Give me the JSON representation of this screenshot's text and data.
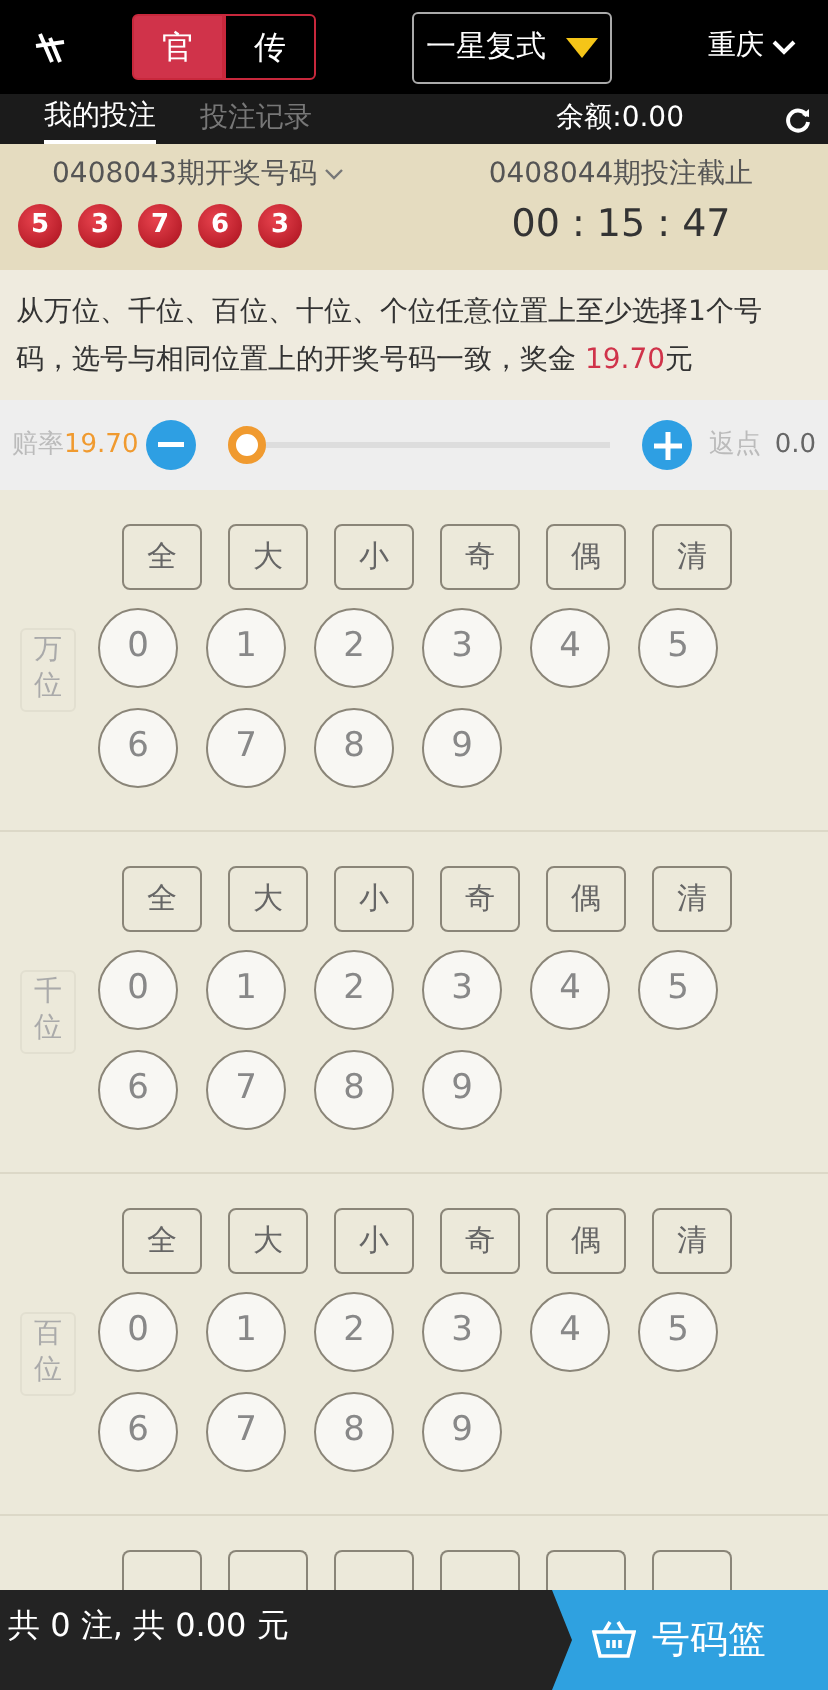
{
  "header": {
    "mode_tabs": [
      {
        "label": "官",
        "selected": true
      },
      {
        "label": "传",
        "selected": false
      }
    ],
    "play_type": "一星复式",
    "region": "重庆"
  },
  "subnav": {
    "tabs": [
      {
        "label": "我的投注",
        "selected": true
      },
      {
        "label": "投注记录",
        "selected": false
      }
    ],
    "balance": "余额:0.00"
  },
  "draw": {
    "last_issue": "0408043期开奖号码",
    "numbers": [
      "5",
      "3",
      "7",
      "6",
      "3"
    ],
    "next_issue": "0408044期投注截止",
    "countdown": "00 : 15 : 47"
  },
  "description": "从万位、千位、百位、十位、个位任意位置上至少选择1个号码，选号与相同位置上的开奖号码一致，奖金 **19.70**元",
  "odds": {
    "label": "赔率",
    "value": "19.70",
    "level": 0,
    "rebate_label": "返点",
    "rebate_value": "0.0"
  },
  "positions": [
    {
      "kind": "full",
      "label": "万位",
      "quick": [
        "全",
        "大",
        "小",
        "奇",
        "偶",
        "清"
      ],
      "digits": [
        {
          "digit": "0",
          "selected": false
        },
        {
          "digit": "1",
          "selected": false
        },
        {
          "digit": "2",
          "selected": false
        },
        {
          "digit": "3",
          "selected": false
        },
        {
          "digit": "4",
          "selected": false
        },
        {
          "digit": "5",
          "selected": false
        },
        {
          "digit": "6",
          "selected": false
        },
        {
          "digit": "7",
          "selected": false
        },
        {
          "digit": "8",
          "selected": false
        },
        {
          "digit": "9",
          "selected": false
        }
      ]
    },
    {
      "kind": "full",
      "label": "千位",
      "quick": [
        "全",
        "大",
        "小",
        "奇",
        "偶",
        "清"
      ],
      "digits": [
        {
          "digit": "0",
          "selected": false
        },
        {
          "digit": "1",
          "selected": false
        },
        {
          "digit": "2",
          "selected": false
        },
        {
          "digit": "3",
          "selected": false
        },
        {
          "digit": "4",
          "selected": false
        },
        {
          "digit": "5",
          "selected": false
        },
        {
          "digit": "6",
          "selected": false
        },
        {
          "digit": "7",
          "selected": false
        },
        {
          "digit": "8",
          "selected": false
        },
        {
          "digit": "9",
          "selected": false
        }
      ]
    },
    {
      "kind": "full",
      "label": "百位",
      "quick": [
        "全",
        "大",
        "小",
        "奇",
        "偶",
        "清"
      ],
      "digits": [
        {
          "digit": "0",
          "selected": false
        },
        {
          "digit": "1",
          "selected": false
        },
        {
          "digit": "2",
          "selected": false
        },
        {
          "digit": "3",
          "selected": false
        },
        {
          "digit": "4",
          "selected": false
        },
        {
          "digit": "5",
          "selected": false
        },
        {
          "digit": "6",
          "selected": false
        },
        {
          "digit": "7",
          "selected": false
        },
        {
          "digit": "8",
          "selected": false
        },
        {
          "digit": "9",
          "selected": false
        }
      ]
    },
    {
      "kind": "cut"
    }
  ],
  "footer": {
    "summary": "共 0 注, 共 0.00 元",
    "basket": "号码篮"
  }
}
